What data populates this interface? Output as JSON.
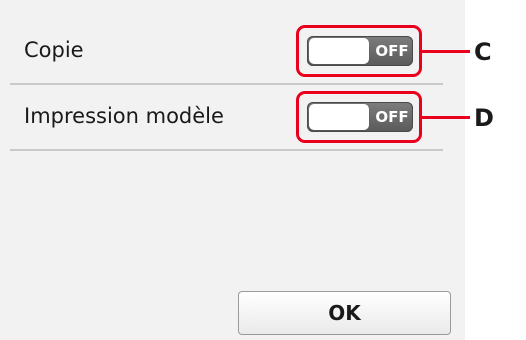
{
  "settings": {
    "rows": [
      {
        "label": "Copie",
        "toggle_state": "OFF",
        "marker": "C"
      },
      {
        "label": "Impression modèle",
        "toggle_state": "OFF",
        "marker": "D"
      }
    ]
  },
  "footer": {
    "ok_label": "OK"
  },
  "colors": {
    "callout": "#e8001c",
    "toggle_off": "#6b6b6b",
    "screen_bg": "#f2f2f2"
  },
  "icons": {
    "toggle": "toggle-switch-icon"
  }
}
